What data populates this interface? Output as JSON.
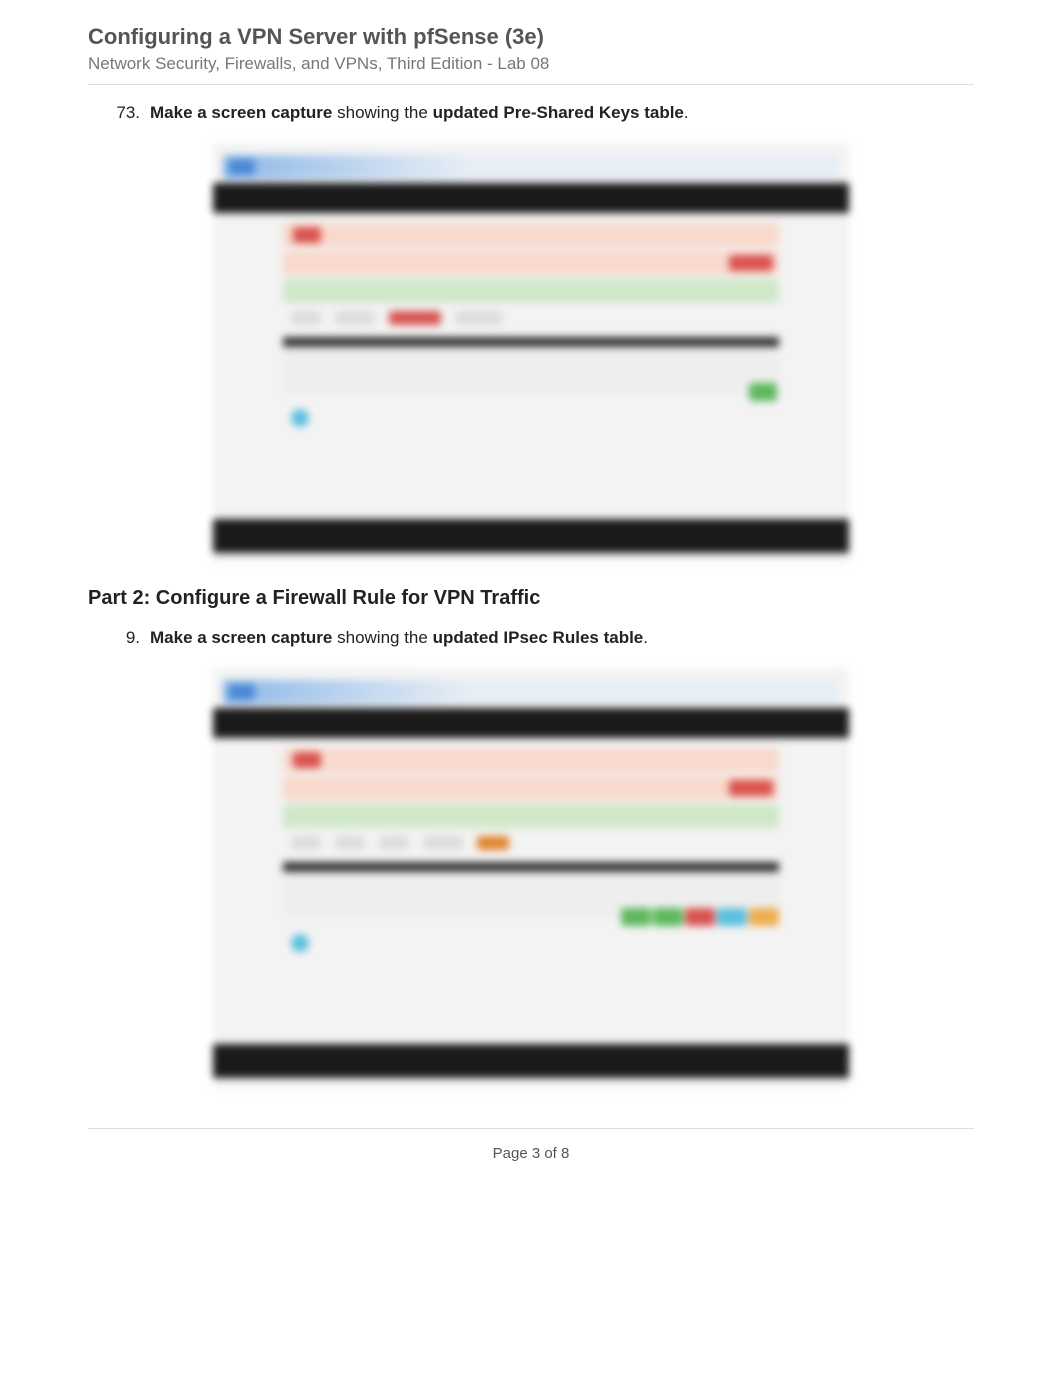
{
  "header": {
    "title": "Configuring a VPN Server with pfSense (3e)",
    "subtitle": "Network Security, Firewalls, and VPNs, Third Edition - Lab 08"
  },
  "steps": {
    "s73": {
      "num": "73.",
      "bold1": "Make a screen capture",
      "mid": " showing the ",
      "bold2": "updated Pre-Shared Keys table",
      "end": "."
    },
    "s9": {
      "num": "9.",
      "bold1": "Make a screen capture",
      "mid": " showing the ",
      "bold2": "updated IPsec Rules table",
      "end": "."
    }
  },
  "part2_heading": "Part 2: Configure a Firewall Rule for VPN Traffic",
  "footer": {
    "page": "Page 3 of 8"
  }
}
